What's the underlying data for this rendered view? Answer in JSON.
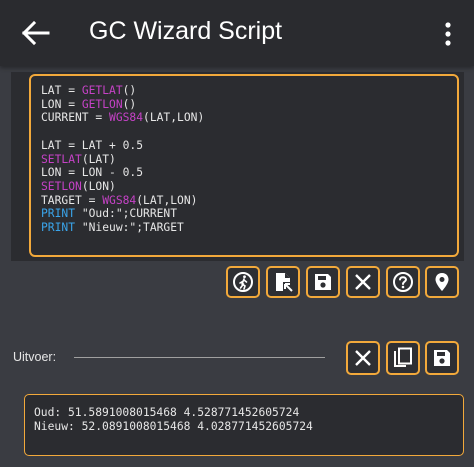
{
  "appbar": {
    "title": "GC Wizard Script",
    "back_icon": "arrow-back-icon",
    "menu_icon": "more-vert-icon"
  },
  "editor": {
    "lines": [
      [
        {
          "t": "LAT = ",
          "c": "plain"
        },
        {
          "t": "GETLAT",
          "c": "fn"
        },
        {
          "t": "()",
          "c": "plain"
        }
      ],
      [
        {
          "t": "LON = ",
          "c": "plain"
        },
        {
          "t": "GETLON",
          "c": "fn"
        },
        {
          "t": "()",
          "c": "plain"
        }
      ],
      [
        {
          "t": "CURRENT = ",
          "c": "plain"
        },
        {
          "t": "WGS84",
          "c": "fn"
        },
        {
          "t": "(LAT,LON)",
          "c": "plain"
        }
      ],
      [],
      [
        {
          "t": "LAT = LAT + 0.5",
          "c": "plain"
        }
      ],
      [
        {
          "t": "SETLAT",
          "c": "fn"
        },
        {
          "t": "(LAT)",
          "c": "plain"
        }
      ],
      [
        {
          "t": "LON = LON - 0.5",
          "c": "plain"
        }
      ],
      [
        {
          "t": "SETLON",
          "c": "fn"
        },
        {
          "t": "(LON)",
          "c": "plain"
        }
      ],
      [
        {
          "t": "TARGET = ",
          "c": "plain"
        },
        {
          "t": "WGS84",
          "c": "fn"
        },
        {
          "t": "(LAT,LON)",
          "c": "plain"
        }
      ],
      [
        {
          "t": "PRINT",
          "c": "kw"
        },
        {
          "t": " \"Oud:\";CURRENT",
          "c": "plain"
        }
      ],
      [
        {
          "t": "PRINT",
          "c": "kw"
        },
        {
          "t": " \"Nieuw:\";TARGET",
          "c": "plain"
        }
      ]
    ]
  },
  "toolbar": {
    "buttons": [
      {
        "name": "run-button",
        "icon": "run-icon"
      },
      {
        "name": "open-file-button",
        "icon": "open-file-icon"
      },
      {
        "name": "save-button",
        "icon": "save-icon"
      },
      {
        "name": "clear-button",
        "icon": "close-icon"
      },
      {
        "name": "help-button",
        "icon": "help-icon"
      },
      {
        "name": "location-button",
        "icon": "location-pin-icon"
      }
    ]
  },
  "output": {
    "label": "Uitvoer:",
    "lines": [
      "Oud: 51.5891008015468 4.528771452605724",
      "Nieuw: 52.0891008015468 4.028771452605724"
    ],
    "buttons": [
      {
        "name": "output-clear-button",
        "icon": "close-icon"
      },
      {
        "name": "output-copy-button",
        "icon": "copy-icon"
      },
      {
        "name": "output-save-button",
        "icon": "save-icon"
      }
    ]
  },
  "colors": {
    "accent": "#f2a93b",
    "function": "#c542c6",
    "keyword": "#3aa4ea",
    "background": "#3a3c42",
    "appbar": "#2a2b2f"
  }
}
